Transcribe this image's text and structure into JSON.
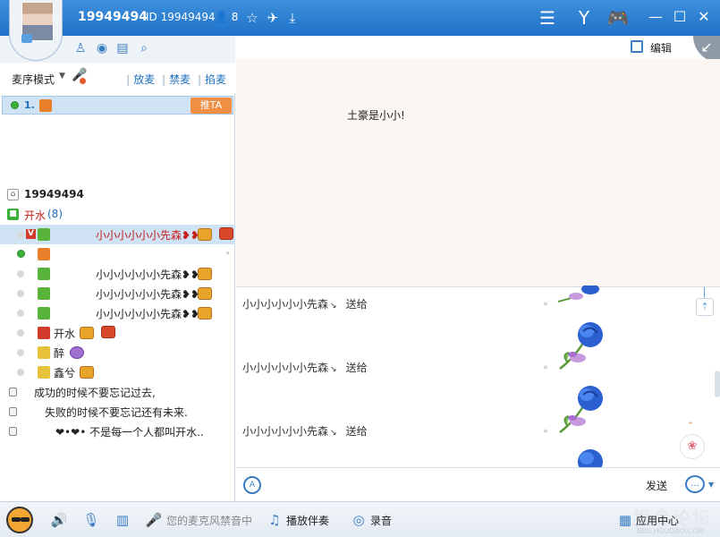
{
  "header": {
    "username": "19949494",
    "id_label": "ID 19949494",
    "online_count": "8",
    "icons": [
      "star-icon",
      "plane-icon",
      "download-icon",
      "list-icon",
      "vip-icon",
      "gamepad-icon"
    ],
    "window_controls": [
      "minimize",
      "maximize",
      "close"
    ]
  },
  "left": {
    "toolbar_icons": [
      "user-group-icon",
      "location-icon",
      "document-edit-icon",
      "search-icon"
    ],
    "mic_mode": "麦序模式",
    "actions": [
      "放麦",
      "禁麦",
      "掐麦"
    ],
    "queue": {
      "number": "1.",
      "push_label": "推TA"
    },
    "tree": {
      "room_name": "19949494",
      "channel_name": "开水",
      "channel_count": "(8)",
      "users": [
        {
          "name": "小小小小小小先森❥❥",
          "status": "idle",
          "selected": true,
          "vip": true
        },
        {
          "name": "",
          "status": "online"
        },
        {
          "name": "小小小小小小先森❥❥",
          "status": "idle"
        },
        {
          "name": "小小小小小小先森❥❥",
          "status": "idle"
        },
        {
          "name": "小小小小小小先森❥❥",
          "status": "idle"
        },
        {
          "name": "开水",
          "status": "idle"
        },
        {
          "name": "醉",
          "status": "idle"
        },
        {
          "name": "鑫兮",
          "status": "idle"
        }
      ],
      "sub_channels": [
        "成功的时候不要忘记过去,",
        "失败的时候不要忘记还有未来.",
        "❤•❤• 不是每一个人都叫开水.."
      ]
    }
  },
  "right": {
    "edit_label": "编辑",
    "notice": "土豪是小小!",
    "messages": [
      {
        "sender": "小小小小小小先森",
        "verb": "送给"
      },
      {
        "sender": "小小小小小小先森",
        "verb": "送给"
      },
      {
        "sender": "小小小小小小先森",
        "verb": "送给"
      }
    ],
    "send_label": "发送"
  },
  "bottom": {
    "mic_muted_text": "您的麦克风禁音中",
    "play_music_label": "播放伴奏",
    "record_label": "录音",
    "app_center_label": "应用中心",
    "watermark": "猴岛论坛",
    "watermark_sub": "BBS.HOUDAO.COM"
  },
  "colors": {
    "title_bar": "#2a7ed2",
    "accent": "#3a7dc4",
    "selection": "#cfe3f5",
    "push_button": "#f08f43",
    "username_red": "#c8201a"
  }
}
